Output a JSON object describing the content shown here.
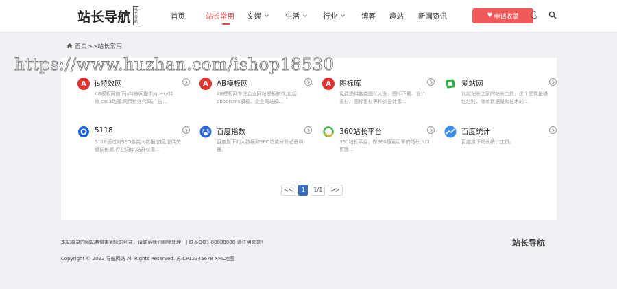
{
  "header": {
    "logo_text": "站长导航",
    "logo_tag": "站长导航",
    "nav": [
      {
        "label": "首页",
        "active": false,
        "dropdown": false
      },
      {
        "label": "站长常用",
        "active": true,
        "dropdown": false
      },
      {
        "label": "文娱",
        "active": false,
        "dropdown": true
      },
      {
        "label": "生活",
        "active": false,
        "dropdown": true
      },
      {
        "label": "行业",
        "active": false,
        "dropdown": true
      },
      {
        "label": "博客",
        "active": false,
        "dropdown": false
      },
      {
        "label": "趣站",
        "active": false,
        "dropdown": false
      },
      {
        "label": "新闻资讯",
        "active": false,
        "dropdown": false
      }
    ],
    "apply_label": "申请收录",
    "accent": "#f05a5a"
  },
  "breadcrumb": "首页>>站长常用",
  "watermark": "https://www.huzhan.com/ishop18530",
  "sites": [
    {
      "name": "js特效网",
      "desc": "AB模板网旗下js特效网提供jquery特效,css3动画,网页特效代码,广告...",
      "icon_text": "A",
      "icon_color": "#e03131"
    },
    {
      "name": "AB模板网",
      "desc": "AB模板网专注企业网站模板制作,包括pbootcms模板、企业网站模...",
      "icon_text": "A",
      "icon_color": "#e03131"
    },
    {
      "name": "图标库",
      "desc": "免费提供各类图标大全、图标下载、设计素材、图标素材等种类设计素...",
      "icon_text": "A",
      "icon_color": "#e03131"
    },
    {
      "name": "爱站网",
      "desc": "比起站长之家的站长工具，这个您算是雄赳赳时，随着数据量和技术的...",
      "icon_text": "",
      "icon_color": "#2fb344"
    },
    {
      "name": "5118",
      "desc": "5118通过对SEO各类大数据挖掘,提供关键词挖掘,行业词库,站群权重...",
      "icon_text": "",
      "icon_color": "#1e62d8"
    },
    {
      "name": "百度指数",
      "desc": "百度旗下的大数据和SEO趋势分析必备利器。",
      "icon_text": "",
      "icon_color": "#2b63d9"
    },
    {
      "name": "360站长平台",
      "desc": "360站长平台，做360搜索引擎的站长入口页面...",
      "icon_text": "",
      "icon_color": "#43b049"
    },
    {
      "name": "百度统计",
      "desc": "百度旗下站长统计工具。",
      "icon_text": "",
      "icon_color": "#3e8ee8"
    }
  ],
  "pager": {
    "prev": "<<",
    "current": "1",
    "total": "1/1",
    "next": ">>"
  },
  "footer": {
    "note": "本站收录的网站若侵害到您的利益，请联系我们删除处理！| 联系QQ：88888888 请注明来意！",
    "copyright": "Copyright © 2022 导航网站 All Rights Reserved. 苏ICP12345678 XML地图",
    "logo_text": "站长导航"
  }
}
